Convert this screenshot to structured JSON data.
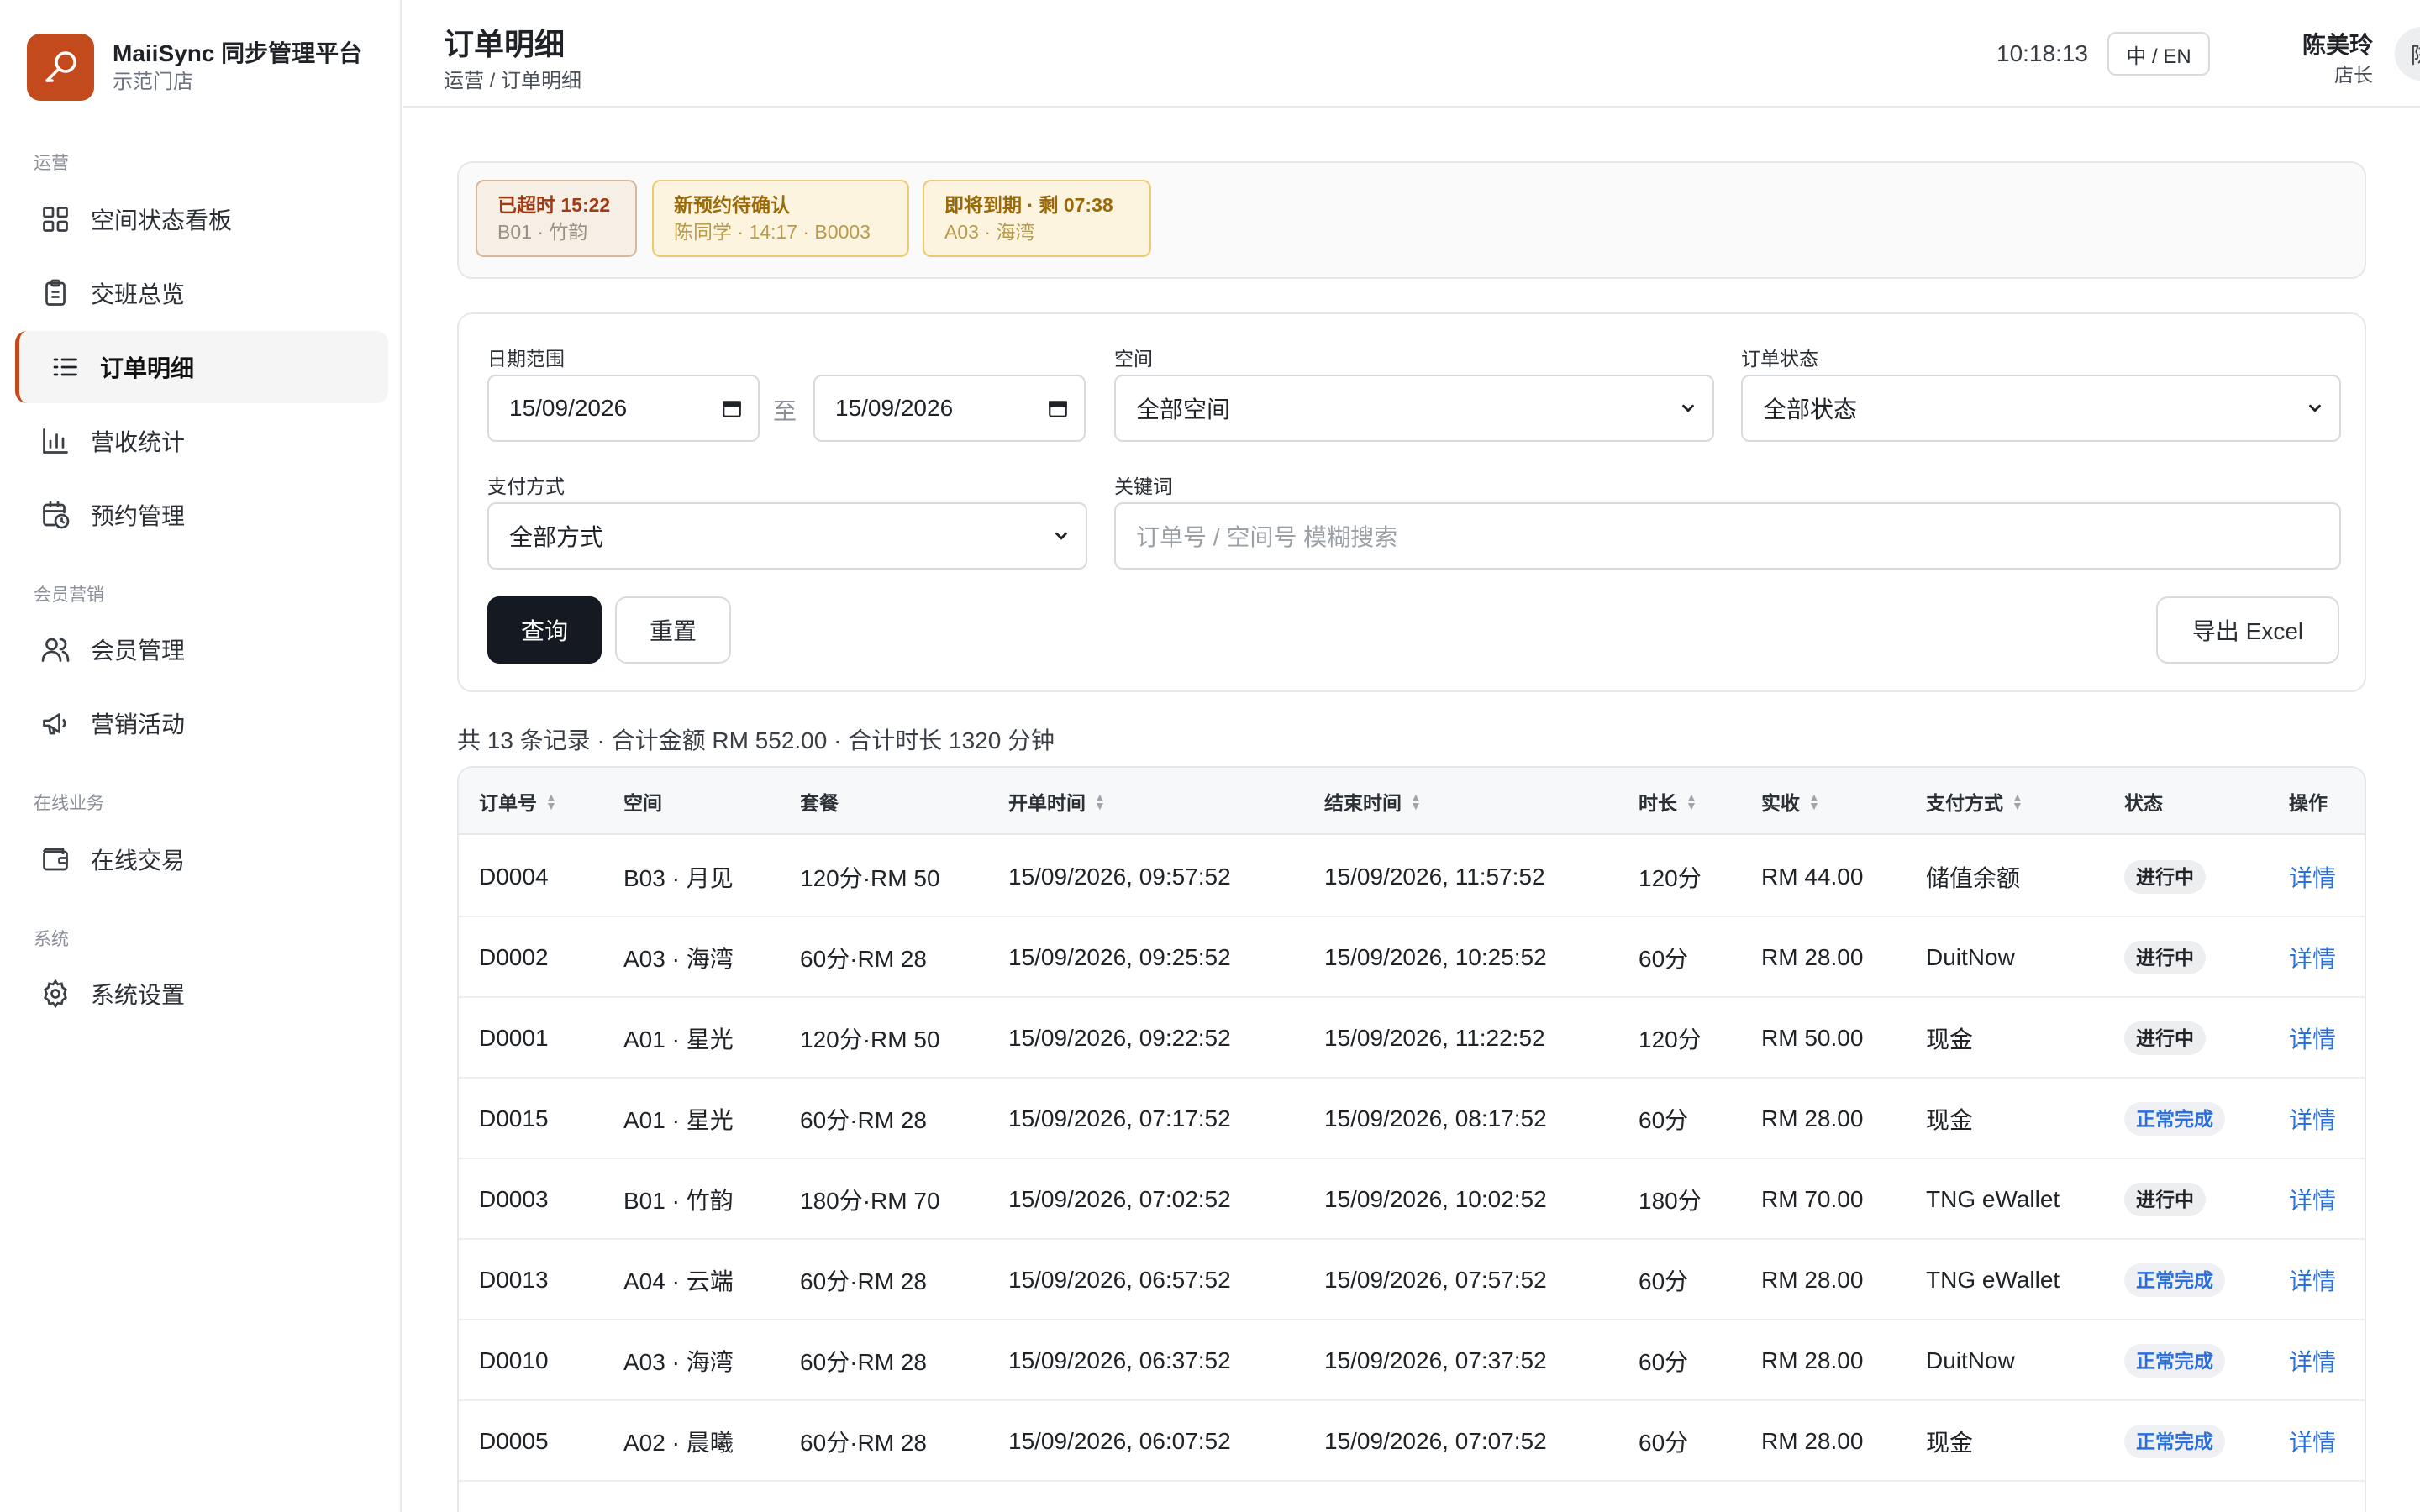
{
  "brand": {
    "title": "MaiiSync 同步管理平台",
    "subtitle": "示范门店"
  },
  "sidebar": {
    "groups": [
      {
        "label": "运营"
      },
      {
        "label": "会员营销"
      },
      {
        "label": "在线业务"
      },
      {
        "label": "系统"
      }
    ],
    "items": [
      {
        "label": "空间状态看板",
        "icon": "grid-icon"
      },
      {
        "label": "交班总览",
        "icon": "clipboard-icon"
      },
      {
        "label": "订单明细",
        "icon": "list-icon",
        "active": true
      },
      {
        "label": "营收统计",
        "icon": "bar-chart-icon"
      },
      {
        "label": "预约管理",
        "icon": "calendar-clock-icon"
      },
      {
        "label": "会员管理",
        "icon": "users-icon"
      },
      {
        "label": "营销活动",
        "icon": "megaphone-icon"
      },
      {
        "label": "在线交易",
        "icon": "wallet-icon"
      },
      {
        "label": "系统设置",
        "icon": "gear-icon"
      }
    ]
  },
  "header": {
    "title": "订单明细",
    "breadcrumb": "运营 / 订单明细",
    "clock": "10:18:13",
    "lang": "中 / EN",
    "user_name": "陈美玲",
    "user_role": "店长",
    "avatar": "陈"
  },
  "alerts": [
    {
      "title": "已超时 15:22",
      "sub": "B01 · 竹韵",
      "tone": "red"
    },
    {
      "title": "新预约待确认",
      "sub": "陈同学 · 14:17 · B0003",
      "tone": "yellow"
    },
    {
      "title": "即将到期 · 剩 07:38",
      "sub": "A03 · 海湾",
      "tone": "yellow"
    }
  ],
  "filters": {
    "date_label": "日期范围",
    "date_from": "15/09/2026",
    "date_sep": "至",
    "date_to": "15/09/2026",
    "space_label": "空间",
    "space_value": "全部空间",
    "status_label": "订单状态",
    "status_value": "全部状态",
    "payment_label": "支付方式",
    "payment_value": "全部方式",
    "keyword_label": "关键词",
    "keyword_placeholder": "订单号 / 空间号 模糊搜索",
    "query_label": "查询",
    "reset_label": "重置",
    "export_label": "导出 Excel"
  },
  "summary": "共 13 条记录 · 合计金额 RM 552.00 · 合计时长 1320 分钟",
  "table": {
    "columns": [
      "订单号",
      "空间",
      "套餐",
      "开单时间",
      "结束时间",
      "时长",
      "实收",
      "支付方式",
      "状态",
      "操作"
    ],
    "action_label": "详情",
    "rows": [
      {
        "id": "D0004",
        "space": "B03 · 月见",
        "plan": "120分·RM 50",
        "start": "15/09/2026, 09:57:52",
        "end": "15/09/2026, 11:57:52",
        "duration": "120分",
        "paid": "RM 44.00",
        "method": "储值余额",
        "status": "进行中",
        "status_type": "ongoing"
      },
      {
        "id": "D0002",
        "space": "A03 · 海湾",
        "plan": "60分·RM 28",
        "start": "15/09/2026, 09:25:52",
        "end": "15/09/2026, 10:25:52",
        "duration": "60分",
        "paid": "RM 28.00",
        "method": "DuitNow",
        "status": "进行中",
        "status_type": "ongoing"
      },
      {
        "id": "D0001",
        "space": "A01 · 星光",
        "plan": "120分·RM 50",
        "start": "15/09/2026, 09:22:52",
        "end": "15/09/2026, 11:22:52",
        "duration": "120分",
        "paid": "RM 50.00",
        "method": "现金",
        "status": "进行中",
        "status_type": "ongoing"
      },
      {
        "id": "D0015",
        "space": "A01 · 星光",
        "plan": "60分·RM 28",
        "start": "15/09/2026, 07:17:52",
        "end": "15/09/2026, 08:17:52",
        "duration": "60分",
        "paid": "RM 28.00",
        "method": "现金",
        "status": "正常完成",
        "status_type": "done"
      },
      {
        "id": "D0003",
        "space": "B01 · 竹韵",
        "plan": "180分·RM 70",
        "start": "15/09/2026, 07:02:52",
        "end": "15/09/2026, 10:02:52",
        "duration": "180分",
        "paid": "RM 70.00",
        "method": "TNG eWallet",
        "status": "进行中",
        "status_type": "ongoing"
      },
      {
        "id": "D0013",
        "space": "A04 · 云端",
        "plan": "60分·RM 28",
        "start": "15/09/2026, 06:57:52",
        "end": "15/09/2026, 07:57:52",
        "duration": "60分",
        "paid": "RM 28.00",
        "method": "TNG eWallet",
        "status": "正常完成",
        "status_type": "done"
      },
      {
        "id": "D0010",
        "space": "A03 · 海湾",
        "plan": "60分·RM 28",
        "start": "15/09/2026, 06:37:52",
        "end": "15/09/2026, 07:37:52",
        "duration": "60分",
        "paid": "RM 28.00",
        "method": "DuitNow",
        "status": "正常完成",
        "status_type": "done"
      },
      {
        "id": "D0005",
        "space": "A02 · 晨曦",
        "plan": "60分·RM 28",
        "start": "15/09/2026, 06:07:52",
        "end": "15/09/2026, 07:07:52",
        "duration": "60分",
        "paid": "RM 28.00",
        "method": "现金",
        "status": "正常完成",
        "status_type": "done"
      }
    ]
  },
  "colors": {
    "accent": "#c24a1c",
    "primary_button": "#151a22",
    "link": "#2a6fdb"
  }
}
